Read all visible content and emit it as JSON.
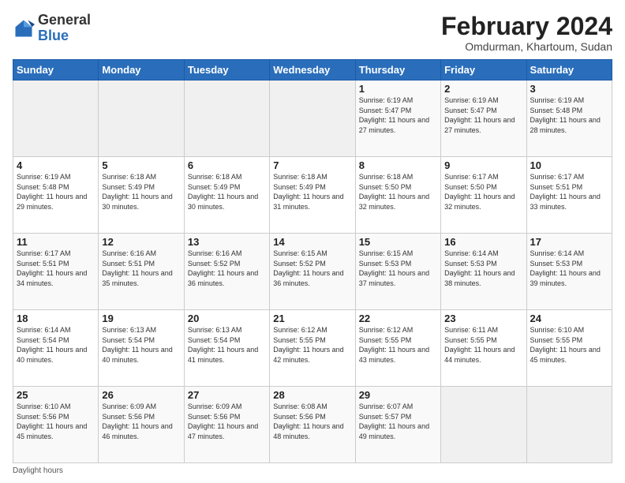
{
  "header": {
    "logo_general": "General",
    "logo_blue": "Blue",
    "month_title": "February 2024",
    "location": "Omdurman, Khartoum, Sudan"
  },
  "days_of_week": [
    "Sunday",
    "Monday",
    "Tuesday",
    "Wednesday",
    "Thursday",
    "Friday",
    "Saturday"
  ],
  "footer_label": "Daylight hours",
  "weeks": [
    [
      {
        "day": "",
        "info": ""
      },
      {
        "day": "",
        "info": ""
      },
      {
        "day": "",
        "info": ""
      },
      {
        "day": "",
        "info": ""
      },
      {
        "day": "1",
        "info": "Sunrise: 6:19 AM\nSunset: 5:47 PM\nDaylight: 11 hours and 27 minutes."
      },
      {
        "day": "2",
        "info": "Sunrise: 6:19 AM\nSunset: 5:47 PM\nDaylight: 11 hours and 27 minutes."
      },
      {
        "day": "3",
        "info": "Sunrise: 6:19 AM\nSunset: 5:48 PM\nDaylight: 11 hours and 28 minutes."
      }
    ],
    [
      {
        "day": "4",
        "info": "Sunrise: 6:19 AM\nSunset: 5:48 PM\nDaylight: 11 hours and 29 minutes."
      },
      {
        "day": "5",
        "info": "Sunrise: 6:18 AM\nSunset: 5:49 PM\nDaylight: 11 hours and 30 minutes."
      },
      {
        "day": "6",
        "info": "Sunrise: 6:18 AM\nSunset: 5:49 PM\nDaylight: 11 hours and 30 minutes."
      },
      {
        "day": "7",
        "info": "Sunrise: 6:18 AM\nSunset: 5:49 PM\nDaylight: 11 hours and 31 minutes."
      },
      {
        "day": "8",
        "info": "Sunrise: 6:18 AM\nSunset: 5:50 PM\nDaylight: 11 hours and 32 minutes."
      },
      {
        "day": "9",
        "info": "Sunrise: 6:17 AM\nSunset: 5:50 PM\nDaylight: 11 hours and 32 minutes."
      },
      {
        "day": "10",
        "info": "Sunrise: 6:17 AM\nSunset: 5:51 PM\nDaylight: 11 hours and 33 minutes."
      }
    ],
    [
      {
        "day": "11",
        "info": "Sunrise: 6:17 AM\nSunset: 5:51 PM\nDaylight: 11 hours and 34 minutes."
      },
      {
        "day": "12",
        "info": "Sunrise: 6:16 AM\nSunset: 5:51 PM\nDaylight: 11 hours and 35 minutes."
      },
      {
        "day": "13",
        "info": "Sunrise: 6:16 AM\nSunset: 5:52 PM\nDaylight: 11 hours and 36 minutes."
      },
      {
        "day": "14",
        "info": "Sunrise: 6:15 AM\nSunset: 5:52 PM\nDaylight: 11 hours and 36 minutes."
      },
      {
        "day": "15",
        "info": "Sunrise: 6:15 AM\nSunset: 5:53 PM\nDaylight: 11 hours and 37 minutes."
      },
      {
        "day": "16",
        "info": "Sunrise: 6:14 AM\nSunset: 5:53 PM\nDaylight: 11 hours and 38 minutes."
      },
      {
        "day": "17",
        "info": "Sunrise: 6:14 AM\nSunset: 5:53 PM\nDaylight: 11 hours and 39 minutes."
      }
    ],
    [
      {
        "day": "18",
        "info": "Sunrise: 6:14 AM\nSunset: 5:54 PM\nDaylight: 11 hours and 40 minutes."
      },
      {
        "day": "19",
        "info": "Sunrise: 6:13 AM\nSunset: 5:54 PM\nDaylight: 11 hours and 40 minutes."
      },
      {
        "day": "20",
        "info": "Sunrise: 6:13 AM\nSunset: 5:54 PM\nDaylight: 11 hours and 41 minutes."
      },
      {
        "day": "21",
        "info": "Sunrise: 6:12 AM\nSunset: 5:55 PM\nDaylight: 11 hours and 42 minutes."
      },
      {
        "day": "22",
        "info": "Sunrise: 6:12 AM\nSunset: 5:55 PM\nDaylight: 11 hours and 43 minutes."
      },
      {
        "day": "23",
        "info": "Sunrise: 6:11 AM\nSunset: 5:55 PM\nDaylight: 11 hours and 44 minutes."
      },
      {
        "day": "24",
        "info": "Sunrise: 6:10 AM\nSunset: 5:55 PM\nDaylight: 11 hours and 45 minutes."
      }
    ],
    [
      {
        "day": "25",
        "info": "Sunrise: 6:10 AM\nSunset: 5:56 PM\nDaylight: 11 hours and 45 minutes."
      },
      {
        "day": "26",
        "info": "Sunrise: 6:09 AM\nSunset: 5:56 PM\nDaylight: 11 hours and 46 minutes."
      },
      {
        "day": "27",
        "info": "Sunrise: 6:09 AM\nSunset: 5:56 PM\nDaylight: 11 hours and 47 minutes."
      },
      {
        "day": "28",
        "info": "Sunrise: 6:08 AM\nSunset: 5:56 PM\nDaylight: 11 hours and 48 minutes."
      },
      {
        "day": "29",
        "info": "Sunrise: 6:07 AM\nSunset: 5:57 PM\nDaylight: 11 hours and 49 minutes."
      },
      {
        "day": "",
        "info": ""
      },
      {
        "day": "",
        "info": ""
      }
    ]
  ]
}
